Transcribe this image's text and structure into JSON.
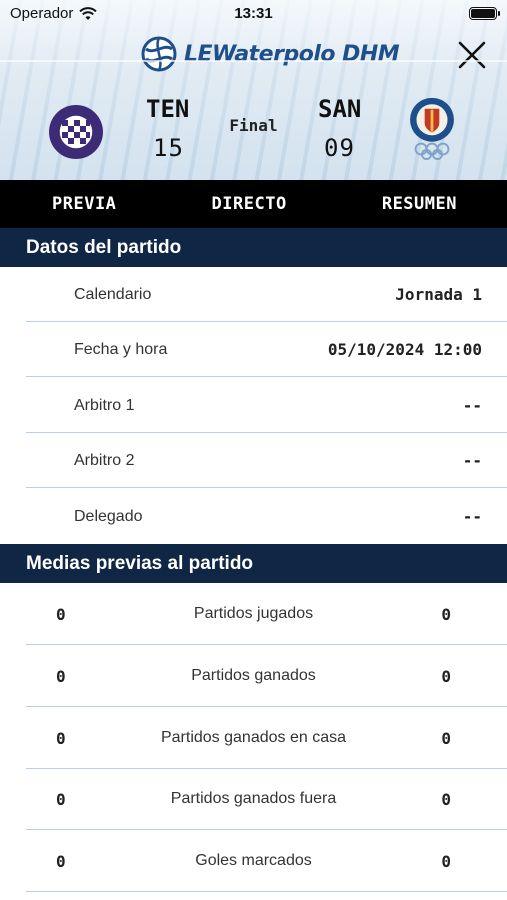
{
  "status_bar": {
    "carrier": "Operador",
    "time": "13:31"
  },
  "brand": {
    "name": "LEWaterpolo DHM"
  },
  "match": {
    "home": {
      "abbr": "TEN",
      "score": "15"
    },
    "away": {
      "abbr": "SAN",
      "score": "09"
    },
    "status": "Final"
  },
  "tabs": [
    {
      "label": "PREVIA"
    },
    {
      "label": "DIRECTO"
    },
    {
      "label": "RESUMEN"
    }
  ],
  "details": {
    "title": "Datos del partido",
    "rows": [
      {
        "label": "Calendario",
        "value": "Jornada 1"
      },
      {
        "label": "Fecha y hora",
        "value": "05/10/2024 12:00"
      },
      {
        "label": "Arbitro 1",
        "value": "--"
      },
      {
        "label": "Arbitro 2",
        "value": "--"
      },
      {
        "label": "Delegado",
        "value": "--"
      }
    ]
  },
  "averages": {
    "title": "Medias previas al partido",
    "rows": [
      {
        "home": "0",
        "label": "Partidos jugados",
        "away": "0"
      },
      {
        "home": "0",
        "label": "Partidos ganados",
        "away": "0"
      },
      {
        "home": "0",
        "label": "Partidos ganados en casa",
        "away": "0"
      },
      {
        "home": "0",
        "label": "Partidos ganados fuera",
        "away": "0"
      },
      {
        "home": "0",
        "label": "Goles marcados",
        "away": "0"
      }
    ]
  },
  "colors": {
    "header_navy": "#0f2644",
    "tab_bar": "#000000",
    "divider": "#b7d0ea",
    "brand_blue": "#1f4f8a"
  }
}
